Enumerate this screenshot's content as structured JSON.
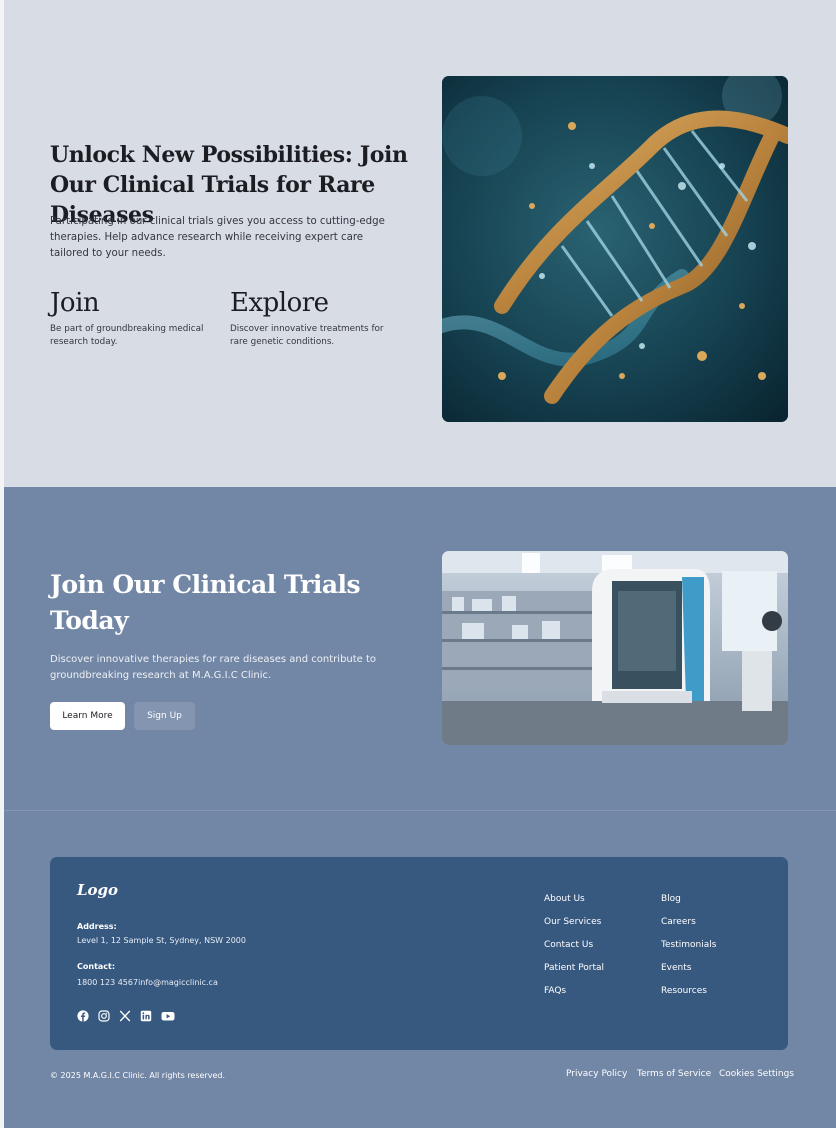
{
  "hero": {
    "title": "Unlock New Possibilities: Join Our Clinical Trials for Rare Diseases",
    "description": "Participating in our clinical trials gives you access to cutting-edge therapies. Help advance research while receiving expert care tailored to your needs.",
    "features": [
      {
        "title": "Join",
        "text": "Be part of groundbreaking medical research today."
      },
      {
        "title": "Explore",
        "text": "Discover innovative treatments for rare genetic conditions."
      }
    ]
  },
  "cta": {
    "title": "Join Our Clinical Trials Today",
    "description": "Discover innovative therapies for rare diseases and contribute to groundbreaking research at M.A.G.I.C Clinic.",
    "primary_label": "Learn More",
    "secondary_label": "Sign Up"
  },
  "footer": {
    "logo": "Logo",
    "address_label": "Address:",
    "address": "Level 1, 12 Sample St, Sydney, NSW 2000",
    "contact_label": "Contact:",
    "contact": "1800 123 4567info@magicclinic.ca",
    "social_icons": [
      "facebook-icon",
      "instagram-icon",
      "x-icon",
      "linkedin-icon",
      "youtube-icon"
    ],
    "links_col1": [
      "About Us",
      "Our Services",
      "Contact Us",
      "Patient Portal",
      "FAQs"
    ],
    "links_col2": [
      "Blog",
      "Careers",
      "Testimonials",
      "Events",
      "Resources"
    ],
    "copyright": "© 2025 M.A.G.I.C Clinic. All rights reserved.",
    "legal": [
      "Privacy Policy",
      "Terms of Service",
      "Cookies Settings"
    ]
  },
  "colors": {
    "hero_bg": "#d8dce5",
    "cta_bg": "#7286a5",
    "footer_card": "#37587f"
  }
}
